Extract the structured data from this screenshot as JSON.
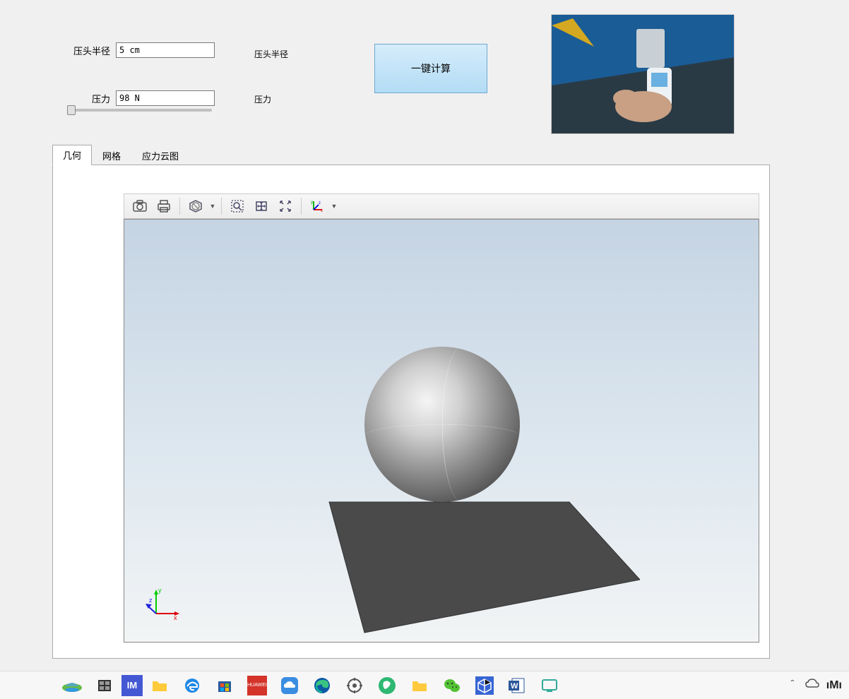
{
  "form": {
    "radius_label": "压头半径",
    "radius_value": "5 cm",
    "pressure_label": "压力",
    "pressure_value": "98 N",
    "radius_label2": "压头半径",
    "pressure_label2": "压力"
  },
  "buttons": {
    "calculate": "一键计算"
  },
  "tabs": {
    "geometry": "几何",
    "mesh": "网格",
    "stress": "应力云图"
  },
  "toolbar": {
    "camera": "camera",
    "print": "print",
    "block": "block",
    "zoom_window": "zoom-window",
    "pan": "pan",
    "fit": "fit",
    "axes": "axes"
  },
  "triad": {
    "x": "x",
    "y": "y",
    "z": "z"
  },
  "taskbar": {
    "icons": [
      "start",
      "task-view",
      "app-im",
      "files",
      "edge-legacy",
      "store",
      "huawei",
      "cloud",
      "edge",
      "settings",
      "bird",
      "folder",
      "wechat",
      "cube-app",
      "word",
      "dev"
    ],
    "tray": [
      "expand",
      "cloud-status",
      "mi"
    ]
  }
}
